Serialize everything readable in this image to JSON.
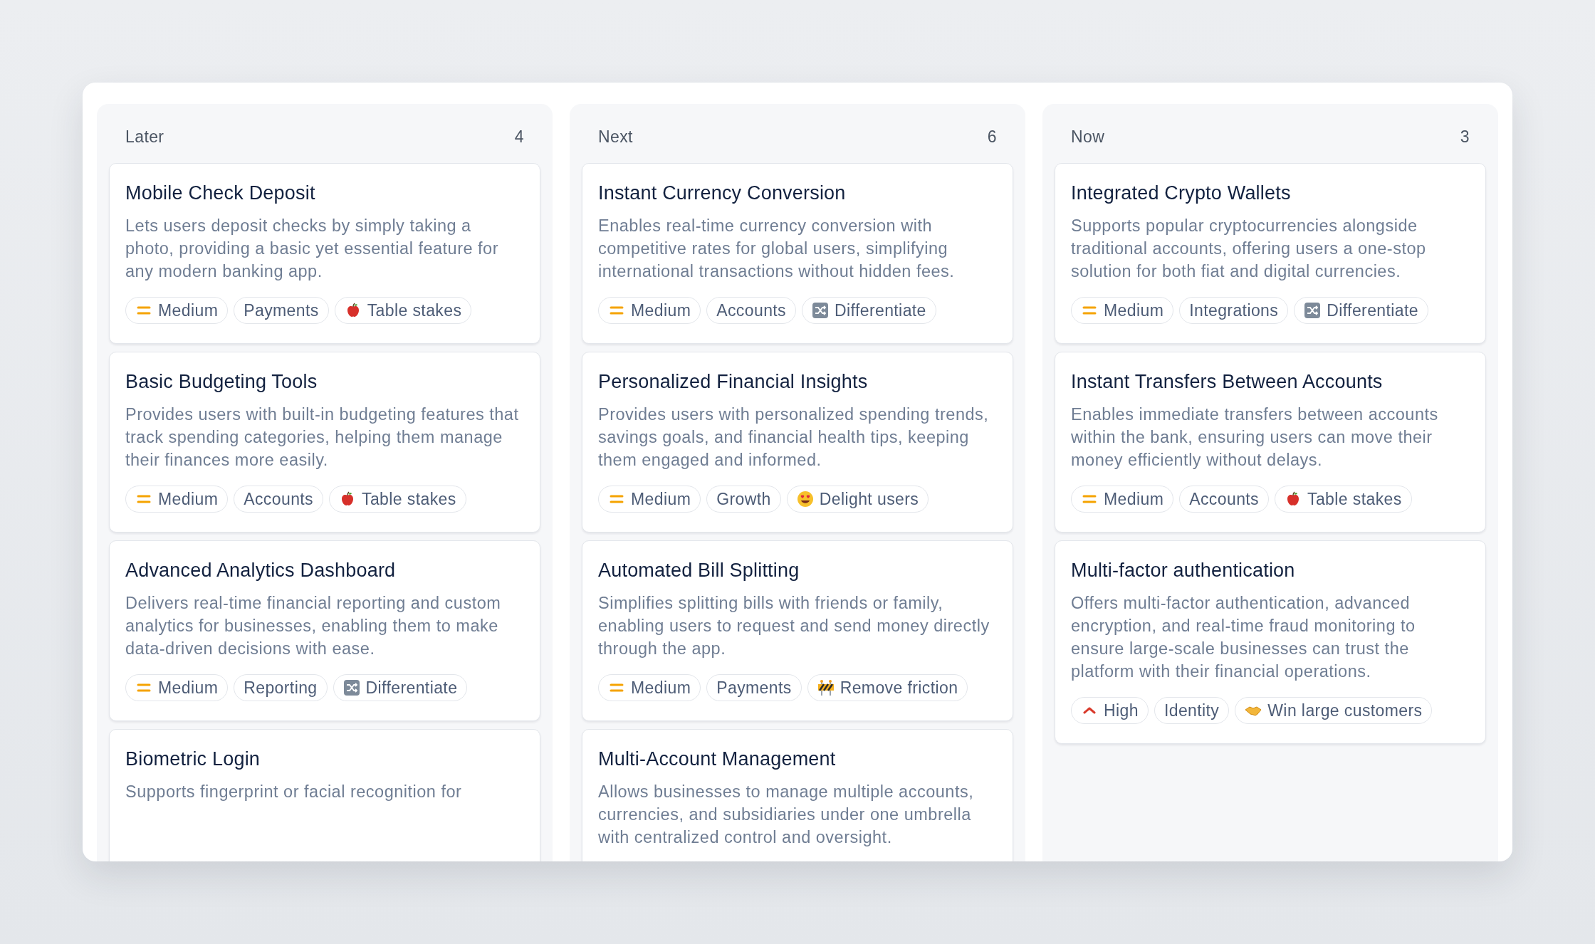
{
  "columns": [
    {
      "title": "Later",
      "count": "4",
      "cards": [
        {
          "title": "Mobile Check Deposit",
          "description": "Lets users deposit checks by simply taking a photo, providing a basic yet essential feature for any modern banking app.",
          "clipped": false,
          "tags": [
            {
              "kind": "medium",
              "label": "Medium"
            },
            {
              "kind": "plain",
              "label": "Payments"
            },
            {
              "kind": "apple",
              "label": "Table stakes"
            }
          ]
        },
        {
          "title": "Basic Budgeting Tools",
          "description": "Provides users with built-in budgeting features that track spending categories, helping them manage their finances more easily.",
          "clipped": false,
          "tags": [
            {
              "kind": "medium",
              "label": "Medium"
            },
            {
              "kind": "plain",
              "label": "Accounts"
            },
            {
              "kind": "apple",
              "label": "Table stakes"
            }
          ]
        },
        {
          "title": "Advanced Analytics Dashboard",
          "description": "Delivers real-time financial reporting and custom analytics for businesses, enabling them to make data-driven decisions with ease.",
          "clipped": false,
          "tags": [
            {
              "kind": "medium",
              "label": "Medium"
            },
            {
              "kind": "plain",
              "label": "Reporting"
            },
            {
              "kind": "shuffle",
              "label": "Differentiate"
            }
          ]
        },
        {
          "title": "Biometric Login",
          "description": "Supports fingerprint or facial recognition for",
          "clipped": true
        }
      ]
    },
    {
      "title": "Next",
      "count": "6",
      "cards": [
        {
          "title": "Instant Currency Conversion",
          "description": "Enables real-time currency conversion with competitive rates for global users, simplifying international transactions without hidden fees.",
          "clipped": false,
          "tags": [
            {
              "kind": "medium",
              "label": "Medium"
            },
            {
              "kind": "plain",
              "label": "Accounts"
            },
            {
              "kind": "shuffle",
              "label": "Differentiate"
            }
          ]
        },
        {
          "title": "Personalized Financial Insights",
          "description": "Provides users with personalized spending trends, savings goals, and financial health tips, keeping them engaged and informed.",
          "clipped": false,
          "tags": [
            {
              "kind": "medium",
              "label": "Medium"
            },
            {
              "kind": "plain",
              "label": "Growth"
            },
            {
              "kind": "hearts",
              "label": "Delight users"
            }
          ]
        },
        {
          "title": "Automated Bill Splitting",
          "description": "Simplifies splitting bills with friends or family, enabling users to request and send money directly through the app.",
          "clipped": false,
          "tags": [
            {
              "kind": "medium",
              "label": "Medium"
            },
            {
              "kind": "plain",
              "label": "Payments"
            },
            {
              "kind": "barrier",
              "label": "Remove friction"
            }
          ]
        },
        {
          "title": "Multi-Account Management",
          "description": "Allows businesses to manage multiple accounts, currencies, and subsidiaries under one umbrella with centralized control and oversight.",
          "clipped": true
        }
      ]
    },
    {
      "title": "Now",
      "count": "3",
      "cards": [
        {
          "title": "Integrated Crypto Wallets",
          "description": "Supports popular cryptocurrencies alongside traditional accounts, offering users a one-stop solution for both fiat and digital currencies.",
          "clipped": false,
          "tags": [
            {
              "kind": "medium",
              "label": "Medium"
            },
            {
              "kind": "plain",
              "label": "Integrations"
            },
            {
              "kind": "shuffle",
              "label": "Differentiate"
            }
          ]
        },
        {
          "title": "Instant Transfers Between Accounts",
          "description": "Enables immediate transfers between accounts within the bank, ensuring users can move their money efficiently without delays.",
          "clipped": false,
          "tags": [
            {
              "kind": "medium",
              "label": "Medium"
            },
            {
              "kind": "plain",
              "label": "Accounts"
            },
            {
              "kind": "apple",
              "label": "Table stakes"
            }
          ]
        },
        {
          "title": "Multi-factor authentication",
          "description": "Offers multi-factor authentication, advanced encryption, and real-time fraud monitoring to ensure large-scale businesses can trust the platform with their financial operations.",
          "clipped": false,
          "tags": [
            {
              "kind": "high",
              "label": "High"
            },
            {
              "kind": "plain",
              "label": "Identity"
            },
            {
              "kind": "handshake",
              "label": "Win large customers"
            }
          ]
        }
      ]
    }
  ]
}
